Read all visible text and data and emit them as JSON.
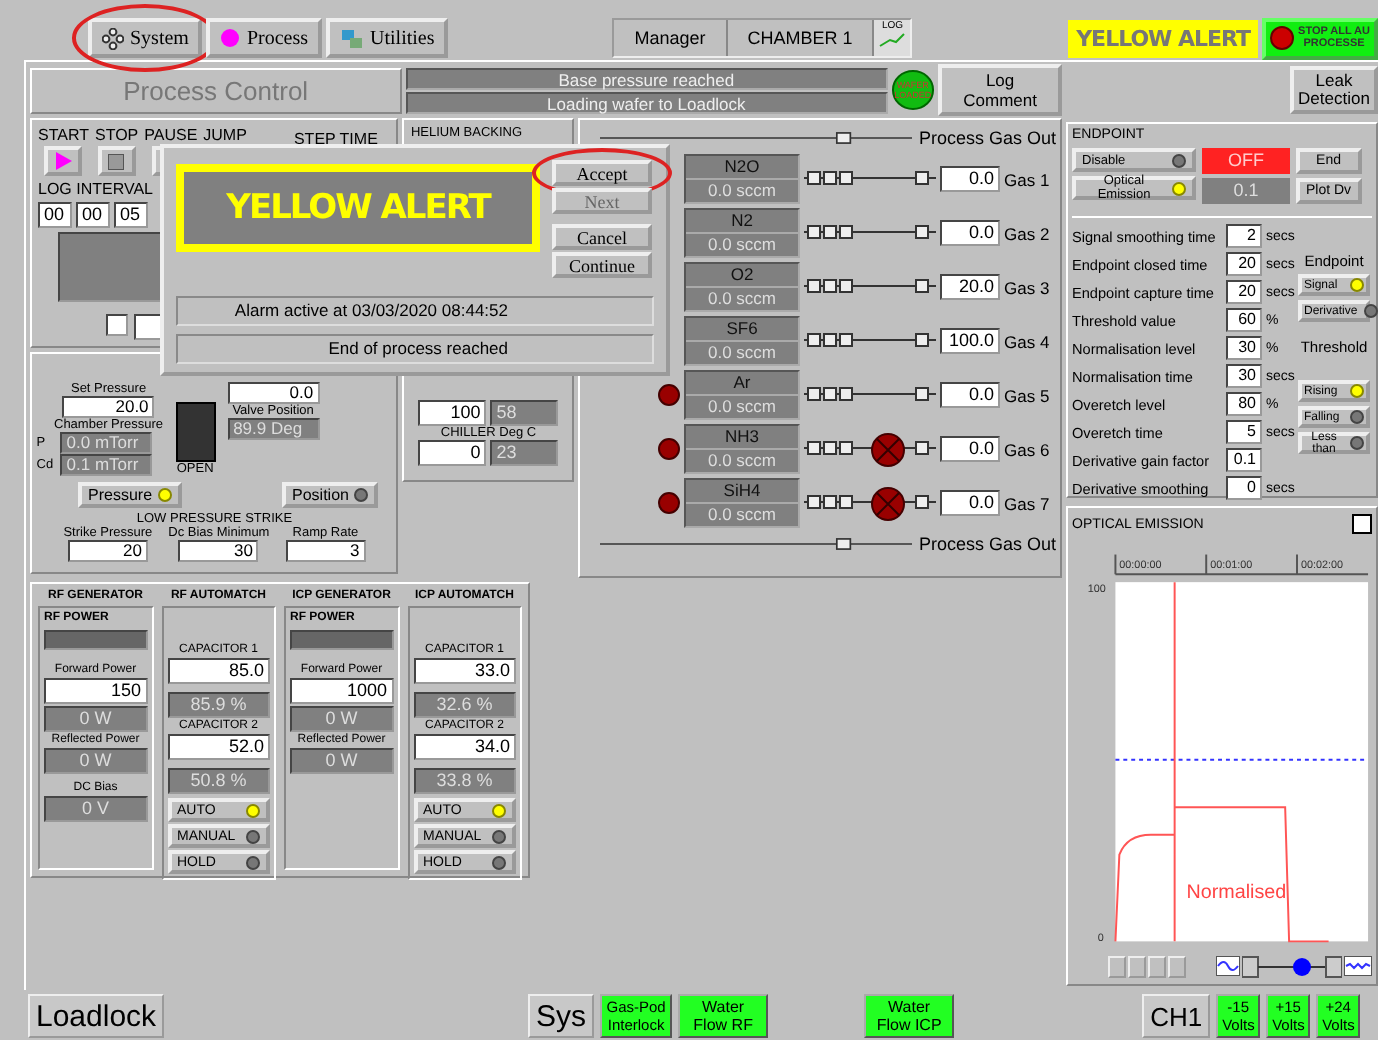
{
  "nav": [
    {
      "label": "System",
      "circled": true
    },
    {
      "label": "Process",
      "circled": false
    },
    {
      "label": "Utilities",
      "circled": false
    }
  ],
  "header": {
    "user": "Manager",
    "chamber": "CHAMBER 1",
    "log_label": "LOG"
  },
  "alert_label": "YELLOW ALERT",
  "stop_button": {
    "lines": [
      "STOP ALL AU",
      "PROCESSE"
    ]
  },
  "process_control": {
    "title": "Process Control",
    "messages": [
      "Base pressure reached",
      "Loading wafer to Loadlock"
    ],
    "wafer_badge": "WAFER LOADED",
    "log_comment": "Log Comment"
  },
  "leak_detection": "Leak Detection",
  "run_controls": {
    "buttons": [
      {
        "label": "START",
        "kind": "play"
      },
      {
        "label": "STOP",
        "kind": "stop"
      },
      {
        "label": "PAUSE",
        "kind": "pause"
      },
      {
        "label": "JUMP",
        "kind": "jump"
      }
    ],
    "step_time_label": "STEP TIME",
    "log_interval_label": "LOG INTERVAL",
    "log_interval": [
      "00",
      "00",
      "05"
    ],
    "log_checkbox": {
      "checked": false
    }
  },
  "pressure": {
    "set_label": "Set Pressure",
    "set_value": "20.0",
    "chamber_label": "Chamber Pressure",
    "readings": [
      {
        "tag": "P",
        "value": "0.0 mTorr"
      },
      {
        "tag": "Cd",
        "value": "0.1 mTorr"
      }
    ],
    "valve_label": "OPEN",
    "valve_value": "0.0",
    "valve_position_label": "Valve Position",
    "valve_position": "89.9 Deg",
    "modes": [
      {
        "label": "Pressure",
        "on": true
      },
      {
        "label": "Position",
        "on": false
      }
    ],
    "strike_title": "LOW PRESSURE STRIKE",
    "strike": [
      {
        "label": "Strike Pressure",
        "value": "20"
      },
      {
        "label": "Dc Bias Minimum",
        "value": "30"
      },
      {
        "label": "Ramp Rate",
        "value": "3"
      }
    ]
  },
  "helium": {
    "title": "HELIUM BACKING",
    "values": [
      "100",
      "58"
    ],
    "chiller_label": "CHILLER Deg C",
    "chiller": [
      "0",
      "23"
    ]
  },
  "gas": {
    "out_top": "Process Gas Out",
    "out_bottom": "Process Gas Out",
    "lines": [
      {
        "name": "N2O",
        "flow": "0.0 sccm",
        "setpoint": "0.0",
        "label": "Gas 1",
        "kind": "plain"
      },
      {
        "name": "N2",
        "flow": "0.0 sccm",
        "setpoint": "0.0",
        "label": "Gas 2",
        "kind": "plain"
      },
      {
        "name": "O2",
        "flow": "0.0 sccm",
        "setpoint": "20.0",
        "label": "Gas 3",
        "kind": "plain"
      },
      {
        "name": "SF6",
        "flow": "0.0 sccm",
        "setpoint": "100.0",
        "label": "Gas 4",
        "kind": "plain"
      },
      {
        "name": "Ar",
        "flow": "0.0 sccm",
        "setpoint": "0.0",
        "label": "Gas 5",
        "kind": "valved"
      },
      {
        "name": "NH3",
        "flow": "0.0 sccm",
        "setpoint": "0.0",
        "label": "Gas 6",
        "kind": "isolated"
      },
      {
        "name": "SiH4",
        "flow": "0.0 sccm",
        "setpoint": "0.0",
        "label": "Gas 7",
        "kind": "isolated"
      }
    ]
  },
  "endpoint": {
    "title": "ENDPOINT",
    "sources": [
      {
        "label": "Disable",
        "on": false
      },
      {
        "label": "Optical Emission",
        "on": true
      }
    ],
    "status": "OFF",
    "value": "0.1",
    "end_button": "End",
    "plot_button": "Plot Dv",
    "params": [
      {
        "label": "Signal smoothing time",
        "value": "2",
        "unit": "secs"
      },
      {
        "label": "Endpoint closed time",
        "value": "20",
        "unit": "secs"
      },
      {
        "label": "Endpoint capture time",
        "value": "20",
        "unit": "secs"
      },
      {
        "label": "Threshold value",
        "value": "60",
        "unit": "%"
      },
      {
        "label": "Normalisation level",
        "value": "30",
        "unit": "%"
      },
      {
        "label": "Normalisation time",
        "value": "30",
        "unit": "secs"
      },
      {
        "label": "Overetch level",
        "value": "80",
        "unit": "%"
      },
      {
        "label": "Overetch time",
        "value": "5",
        "unit": "secs"
      },
      {
        "label": "Derivative gain factor",
        "value": "0.1"
      },
      {
        "label": "Derivative smoothing",
        "value": "0",
        "unit": "secs"
      }
    ],
    "endpoint_label": "Endpoint",
    "signal_modes": [
      {
        "label": "Signal",
        "on": true
      },
      {
        "label": "Derivative",
        "on": false
      }
    ],
    "threshold_label": "Threshold",
    "threshold_modes": [
      {
        "label": "Rising",
        "on": true
      },
      {
        "label": "Falling",
        "on": false
      },
      {
        "label": "Less than",
        "on": false
      }
    ]
  },
  "optical": {
    "title": "OPTICAL EMISSION",
    "xticks": [
      "00:00:00",
      "00:01:00",
      "00:02:00"
    ],
    "yticks": [
      "100",
      "0"
    ],
    "trace_label": "Normalised"
  },
  "rf": [
    {
      "title": "RF GENERATOR",
      "kind": "generator",
      "power_label": "RF POWER",
      "forward_label": "Forward Power",
      "forward": "150",
      "forward_reading": "0 W",
      "reflected_label": "Reflected Power",
      "reflected": "0 W",
      "dc_label": "DC Bias",
      "dc": "0 V"
    },
    {
      "title": "RF AUTOMATCH",
      "kind": "automatch",
      "capacitors": [
        {
          "label": "CAPACITOR 1",
          "value": "85.0",
          "reading": "85.9 %"
        },
        {
          "label": "CAPACITOR 2",
          "value": "52.0",
          "reading": "50.8 %"
        }
      ],
      "modes": [
        {
          "label": "AUTO",
          "on": true
        },
        {
          "label": "MANUAL",
          "on": false
        },
        {
          "label": "HOLD",
          "on": false
        }
      ]
    },
    {
      "title": "ICP GENERATOR",
      "kind": "generator",
      "power_label": "RF POWER",
      "forward_label": "Forward Power",
      "forward": "1000",
      "forward_reading": "0 W",
      "reflected_label": "Reflected Power",
      "reflected": "0 W"
    },
    {
      "title": "ICP AUTOMATCH",
      "kind": "automatch",
      "capacitors": [
        {
          "label": "CAPACITOR 1",
          "value": "33.0",
          "reading": "32.6 %"
        },
        {
          "label": "CAPACITOR 2",
          "value": "34.0",
          "reading": "33.8 %"
        }
      ],
      "modes": [
        {
          "label": "AUTO",
          "on": true
        },
        {
          "label": "MANUAL",
          "on": false
        },
        {
          "label": "HOLD",
          "on": false
        }
      ]
    }
  ],
  "dialog": {
    "banner": "YELLOW ALERT",
    "buttons": [
      {
        "label": "Accept",
        "disabled": false,
        "circled": true
      },
      {
        "label": "Next",
        "disabled": true,
        "circled": false
      },
      {
        "label": "Cancel",
        "disabled": false,
        "circled": false
      },
      {
        "label": "Continue",
        "disabled": false,
        "circled": false
      }
    ],
    "messages": [
      "Alarm active at 03/03/2020 08:44:52",
      "End of process reached"
    ]
  },
  "status_bar": {
    "left": "Loadlock",
    "sys": "Sys",
    "indicators": [
      {
        "label": "Gas-Pod Interlock",
        "ok": true
      },
      {
        "label": "Water Flow RF",
        "ok": true
      },
      {
        "label": "Water Flow ICP",
        "ok": true
      }
    ],
    "channel": "CH1",
    "voltages": [
      {
        "label": "-15 Volts",
        "ok": true
      },
      {
        "label": "+15 Volts",
        "ok": true
      },
      {
        "label": "+24 Volts",
        "ok": true
      }
    ]
  }
}
